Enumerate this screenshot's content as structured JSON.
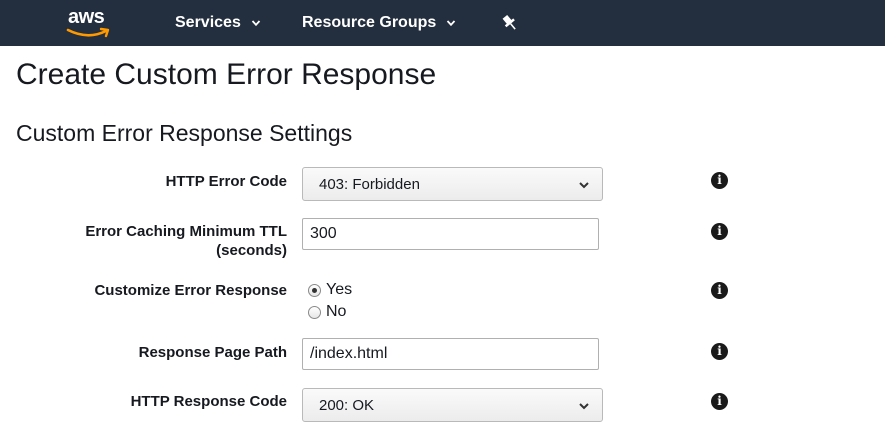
{
  "nav": {
    "logo_text": "aws",
    "services_label": "Services",
    "resource_groups_label": "Resource Groups",
    "colors": {
      "bar": "#232f3e",
      "smile": "#ff9900"
    }
  },
  "page": {
    "title": "Create Custom Error Response",
    "section_title": "Custom Error Response Settings"
  },
  "form": {
    "http_error_code": {
      "label": "HTTP Error Code",
      "selected": "403: Forbidden"
    },
    "error_caching_ttl": {
      "label_line1": "Error Caching Minimum TTL",
      "label_line2": "(seconds)",
      "value": "300"
    },
    "customize_error_response": {
      "label": "Customize Error Response",
      "options": [
        "Yes",
        "No"
      ],
      "selected": "Yes"
    },
    "response_page_path": {
      "label": "Response Page Path",
      "value": "/index.html"
    },
    "http_response_code": {
      "label": "HTTP Response Code",
      "selected": "200: OK"
    },
    "info_glyph": "i"
  }
}
